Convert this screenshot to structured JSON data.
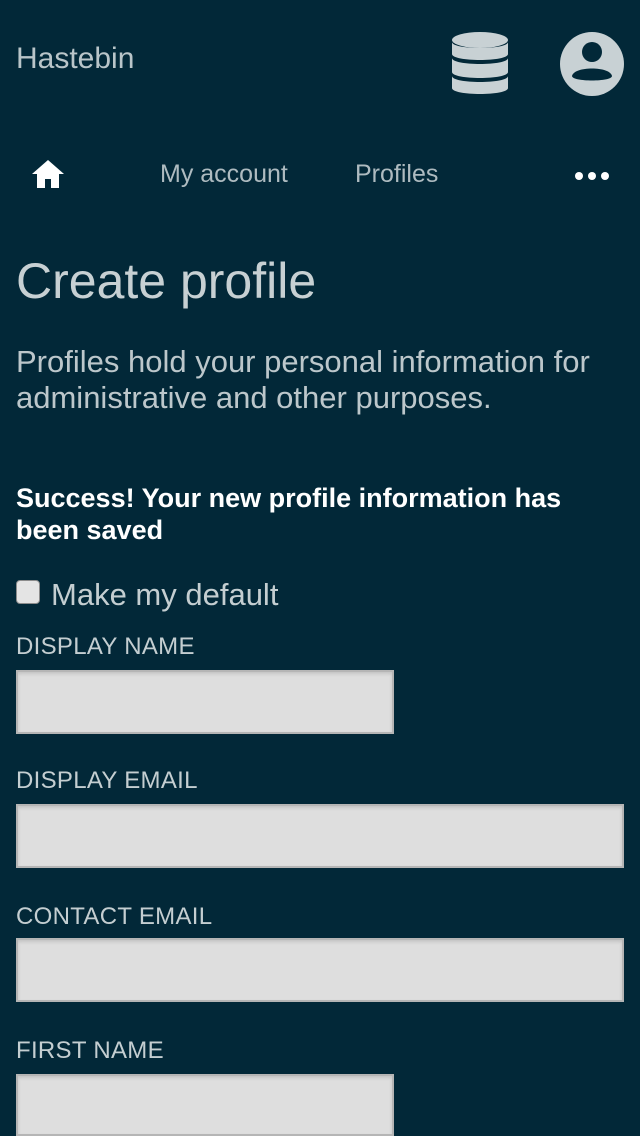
{
  "app": {
    "title": "Hastebin",
    "icons": [
      "database-icon",
      "account-circle-icon"
    ]
  },
  "nav": {
    "home_icon": "home-icon",
    "links": [
      "My account",
      "Profiles"
    ],
    "more_icon": "more-horizontal-icon"
  },
  "page": {
    "title": "Create profile",
    "intro": "Profiles hold your personal information for administrative and other purposes."
  },
  "form": {
    "success_message": "Success! Your new profile information has been saved",
    "default_checkbox": {
      "label": "Make my default",
      "checked": false
    },
    "fields": [
      {
        "label": "DISPLAY NAME",
        "value": "",
        "placeholder": ""
      },
      {
        "label": "DISPLAY EMAIL",
        "value": "",
        "placeholder": ""
      },
      {
        "label": "CONTACT EMAIL",
        "value": "",
        "placeholder": ""
      },
      {
        "label": "FIRST NAME",
        "value": "",
        "placeholder": ""
      }
    ]
  },
  "colors": {
    "background": "#022838",
    "text": "#c4ced1",
    "success_text": "#ffffff",
    "input_background": "#dedede"
  }
}
